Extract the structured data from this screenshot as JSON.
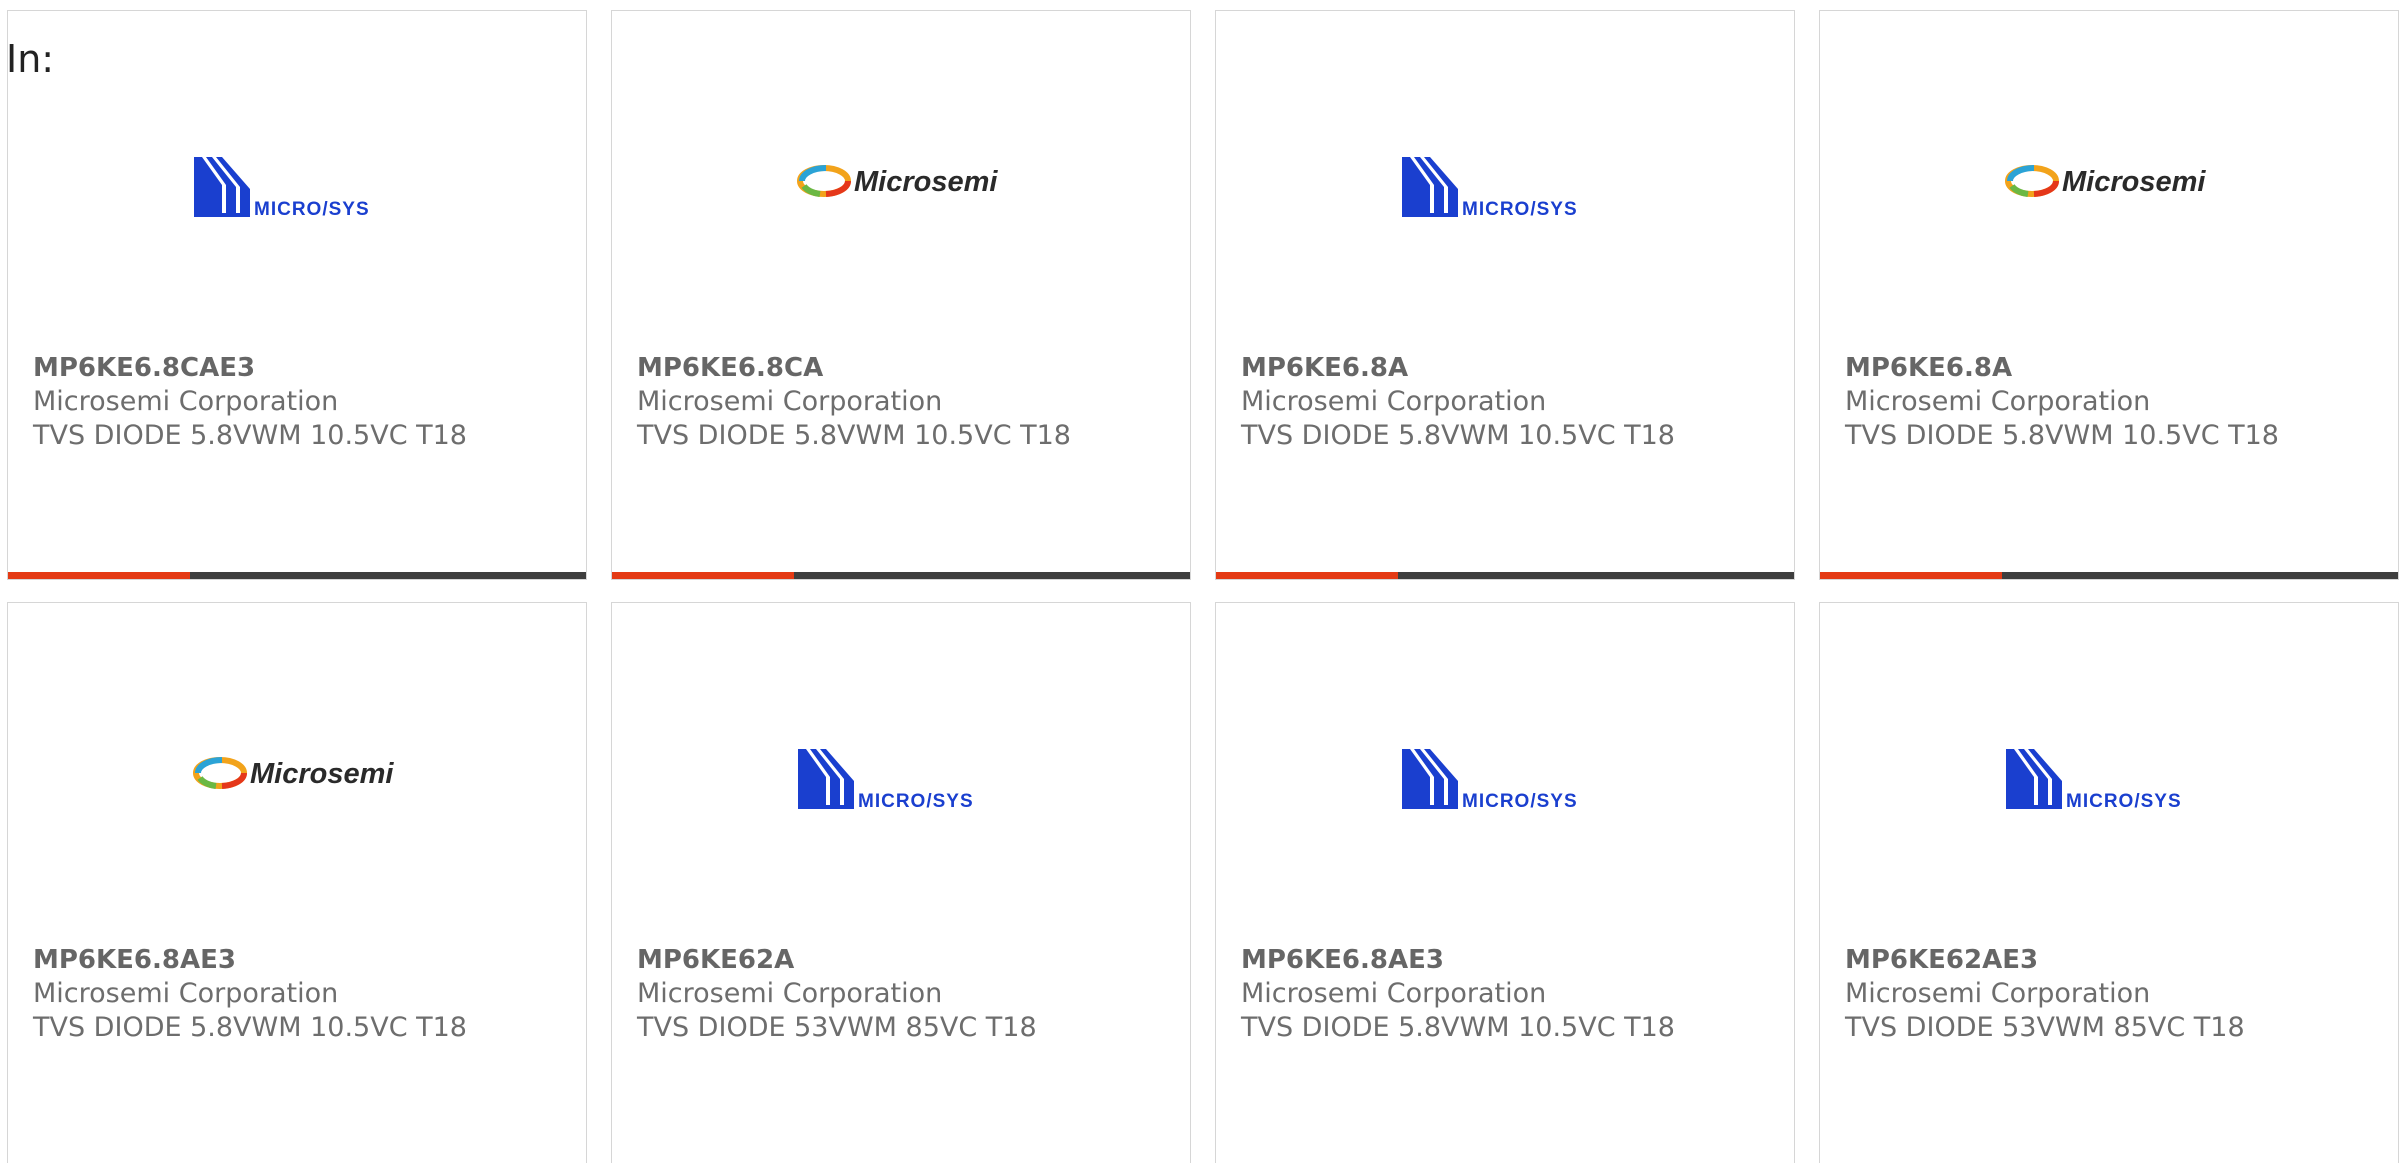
{
  "page": {
    "in_label": "In:"
  },
  "brand_colors": {
    "microsys_blue": "#1a3fcf",
    "microsemi_text": "#2a2a2a",
    "bar_dark": "#3e3e3e",
    "bar_accent": "#e43a14"
  },
  "logos": {
    "microsys": {
      "icon": "microsys-logo-icon",
      "text": "MICRO/SYS"
    },
    "microsemi": {
      "icon": "microsemi-logo-icon",
      "text": "Microsemi"
    }
  },
  "cards": [
    {
      "part": "MP6KE6.8CAE3",
      "manufacturer": "Microsemi Corporation",
      "description": "TVS DIODE 5.8VWM 10.5VC T18",
      "logo": "microsys"
    },
    {
      "part": "MP6KE6.8CA",
      "manufacturer": "Microsemi Corporation",
      "description": "TVS DIODE 5.8VWM 10.5VC T18",
      "logo": "microsemi"
    },
    {
      "part": "MP6KE6.8A",
      "manufacturer": "Microsemi Corporation",
      "description": "TVS DIODE 5.8VWM 10.5VC T18",
      "logo": "microsys"
    },
    {
      "part": "MP6KE6.8A",
      "manufacturer": "Microsemi Corporation",
      "description": "TVS DIODE 5.8VWM 10.5VC T18",
      "logo": "microsemi"
    },
    {
      "part": "MP6KE6.8AE3",
      "manufacturer": "Microsemi Corporation",
      "description": "TVS DIODE 5.8VWM 10.5VC T18",
      "logo": "microsemi"
    },
    {
      "part": "MP6KE62A",
      "manufacturer": "Microsemi Corporation",
      "description": "TVS DIODE 53VWM 85VC T18",
      "logo": "microsys"
    },
    {
      "part": "MP6KE6.8AE3",
      "manufacturer": "Microsemi Corporation",
      "description": "TVS DIODE 5.8VWM 10.5VC T18",
      "logo": "microsys"
    },
    {
      "part": "MP6KE62AE3",
      "manufacturer": "Microsemi Corporation",
      "description": "TVS DIODE 53VWM 85VC T18",
      "logo": "microsys"
    }
  ]
}
